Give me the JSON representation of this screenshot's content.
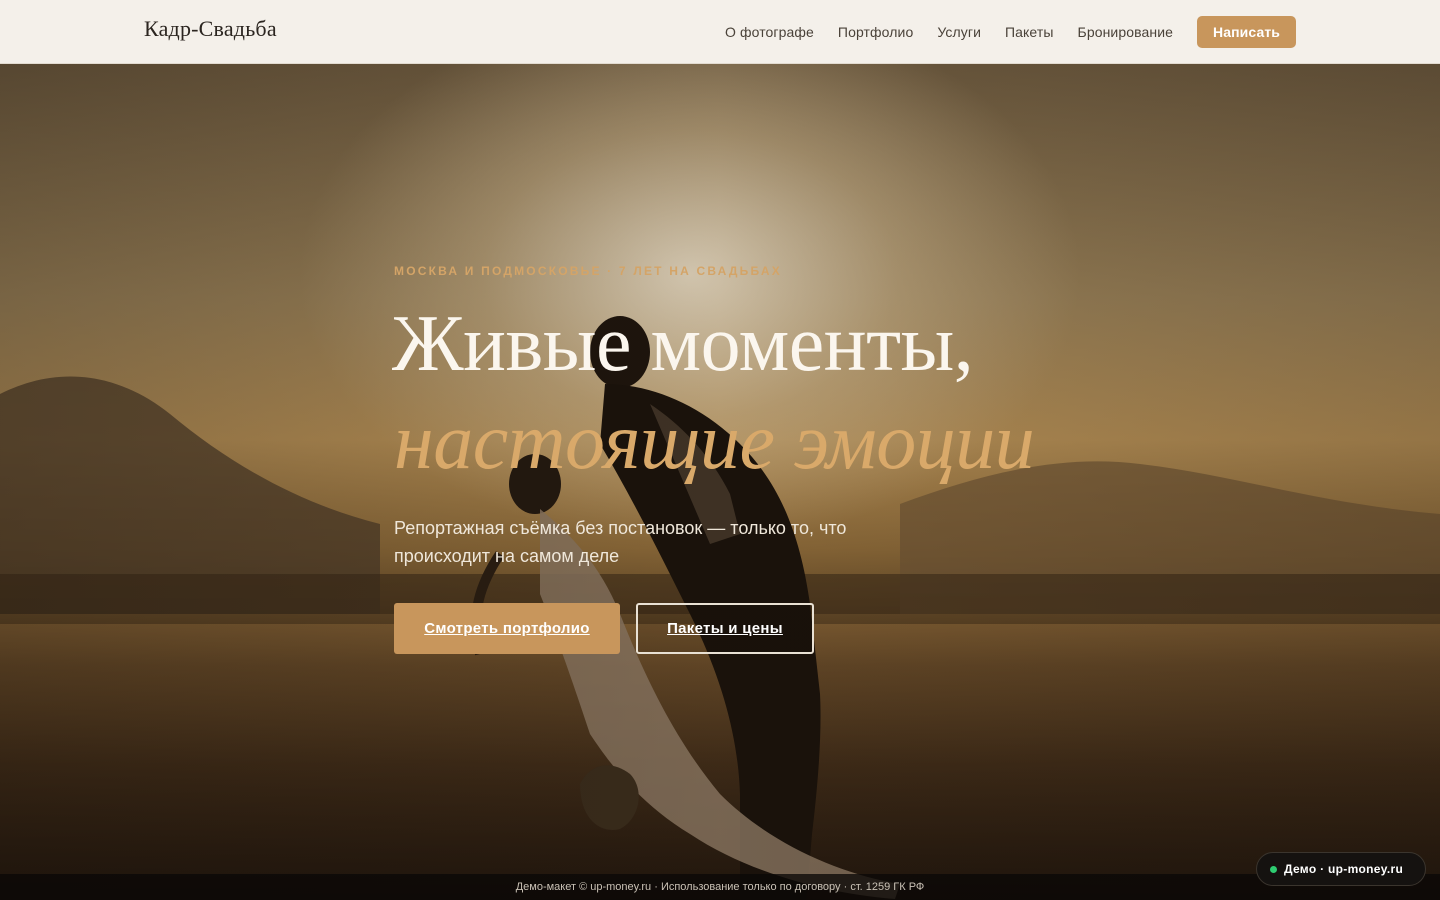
{
  "header": {
    "logo": "Кадр-Свадьба",
    "nav": [
      "О фотографе",
      "Портфолио",
      "Услуги",
      "Пакеты",
      "Бронирование"
    ],
    "cta": "Написать"
  },
  "hero": {
    "eyebrow": "МОСКВА И ПОДМОСКОВЬЕ · 7 ЛЕТ НА СВАДЬБАХ",
    "headline_line1": "Живые моменты,",
    "headline_line2": "настоящие эмоции",
    "lead": "Репортажная съёмка без постановок — только то, что происходит на самом деле",
    "primary_button": "Смотреть портфолио",
    "secondary_button": "Пакеты и цены"
  },
  "footer": {
    "notice": "Демо-макет © up-money.ru · Использование только по договору · ст. 1259 ГК РФ"
  },
  "badge": {
    "label": "Демо · up-money.ru",
    "status_color": "#2ecc71"
  },
  "colors": {
    "accent": "#c8965c",
    "header_bg": "#f4f0ea",
    "headline_italic": "#d9a96a"
  }
}
